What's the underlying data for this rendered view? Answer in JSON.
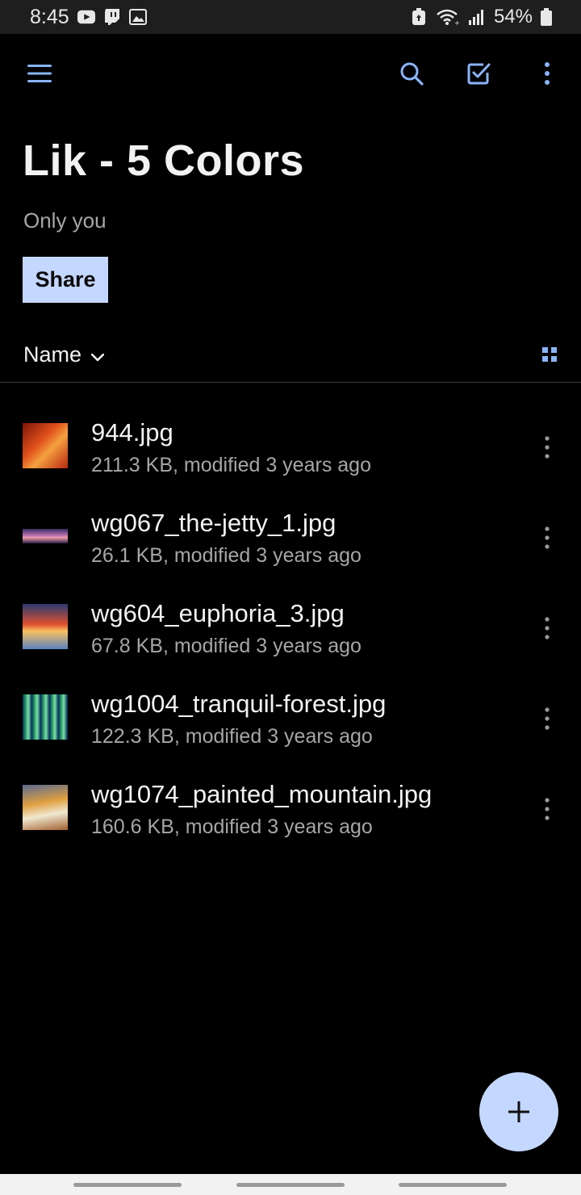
{
  "status_bar": {
    "time": "8:45",
    "battery": "54%",
    "icons": [
      "youtube-icon",
      "twitch-icon",
      "gallery-icon",
      "battery-saver-icon",
      "wifi-icon",
      "signal-icon",
      "battery-icon"
    ]
  },
  "toolbar": {
    "icons": [
      "menu-icon",
      "search-icon",
      "select-icon",
      "more-vert-icon"
    ]
  },
  "header": {
    "title": "Lik - 5 Colors",
    "sharing": "Only you",
    "share_label": "Share"
  },
  "sort": {
    "label": "Name",
    "view_icon": "grid-view-icon"
  },
  "files": [
    {
      "name": "944.jpg",
      "meta": "211.3 KB, modified 3 years ago",
      "thumb_colors": [
        "#7a1408",
        "#e0501a",
        "#f5a040",
        "#b82810"
      ]
    },
    {
      "name": "wg067_the-jetty_1.jpg",
      "meta": "26.1 KB, modified 3 years ago",
      "thumb_colors": [
        "#3a2a60",
        "#b870b0",
        "#f09ab0",
        "#2a2040"
      ]
    },
    {
      "name": "wg604_euphoria_3.jpg",
      "meta": "67.8 KB, modified 3 years ago",
      "thumb_colors": [
        "#2a3a70",
        "#e05030",
        "#f8c060",
        "#5a80c0"
      ]
    },
    {
      "name": "wg1004_tranquil-forest.jpg",
      "meta": "122.3 KB, modified 3 years ago",
      "thumb_colors": [
        "#0a2a50",
        "#2aa070",
        "#80e0a0",
        "#0a4070"
      ]
    },
    {
      "name": "wg1074_painted_mountain.jpg",
      "meta": "160.6 KB, modified 3 years ago",
      "thumb_colors": [
        "#5a6a90",
        "#e0a040",
        "#f0e8d0",
        "#a06030"
      ]
    }
  ],
  "fab": {
    "icon": "add-icon"
  },
  "colors": {
    "accent": "#c4d7ff",
    "icon_blue": "#8ab4f8",
    "background": "#000000",
    "secondary_text": "#a6a6a6"
  }
}
